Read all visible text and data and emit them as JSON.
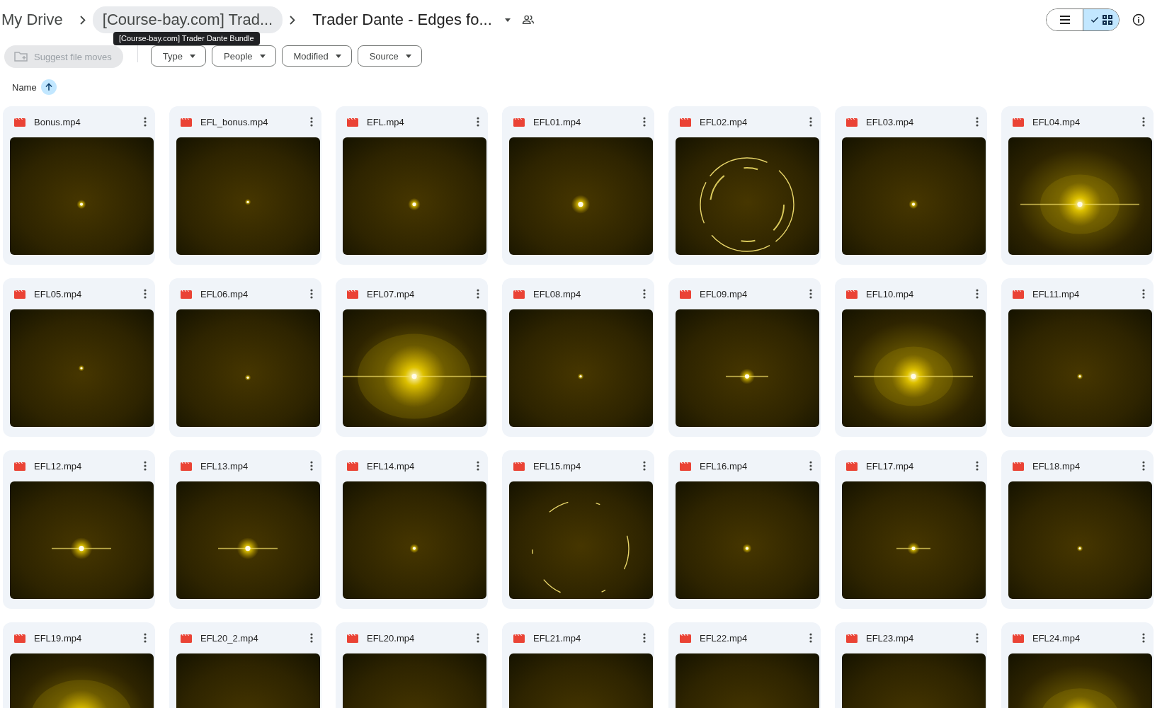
{
  "breadcrumb": [
    {
      "label": "My Drive",
      "hovered": false
    },
    {
      "label": "[Course-bay.com] Trad...",
      "hovered": true
    },
    {
      "label": "Trader Dante - Edges fo...",
      "current": true,
      "shared": true
    }
  ],
  "tooltip": "[Course-bay.com] Trader Dante Bundle",
  "view_toggle": [
    {
      "kind": "list",
      "selected": false
    },
    {
      "kind": "grid",
      "selected": true
    }
  ],
  "suggest_button": {
    "label": "Suggest file moves",
    "disabled": true
  },
  "filters": [
    "Type",
    "People",
    "Modified",
    "Source"
  ],
  "sort": {
    "label": "Name",
    "ascending": true
  },
  "files": [
    {
      "name": "Bonus.mp4"
    },
    {
      "name": "EFL_bonus.mp4"
    },
    {
      "name": "EFL.mp4"
    },
    {
      "name": "EFL01.mp4"
    },
    {
      "name": "EFL02.mp4"
    },
    {
      "name": "EFL03.mp4"
    },
    {
      "name": "EFL04.mp4"
    },
    {
      "name": "EFL05.mp4"
    },
    {
      "name": "EFL06.mp4"
    },
    {
      "name": "EFL07.mp4"
    },
    {
      "name": "EFL08.mp4"
    },
    {
      "name": "EFL09.mp4"
    },
    {
      "name": "EFL10.mp4"
    },
    {
      "name": "EFL11.mp4"
    },
    {
      "name": "EFL12.mp4"
    },
    {
      "name": "EFL13.mp4"
    },
    {
      "name": "EFL14.mp4"
    },
    {
      "name": "EFL15.mp4"
    },
    {
      "name": "EFL16.mp4"
    },
    {
      "name": "EFL17.mp4"
    },
    {
      "name": "EFL18.mp4"
    },
    {
      "name": "EFL19.mp4"
    },
    {
      "name": "EFL20_2.mp4"
    },
    {
      "name": "EFL20.mp4"
    },
    {
      "name": "EFL21.mp4"
    },
    {
      "name": "EFL22.mp4"
    },
    {
      "name": "EFL23.mp4"
    },
    {
      "name": "EFL24.mp4"
    }
  ]
}
